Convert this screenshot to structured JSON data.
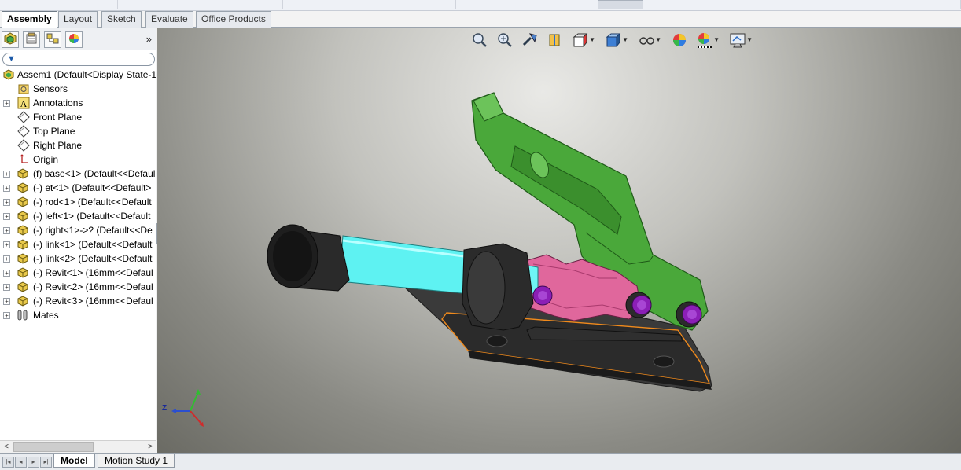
{
  "command_manager": {
    "tabs": [
      {
        "label": "Assembly",
        "active": true
      },
      {
        "label": "Layout",
        "active": false
      },
      {
        "label": "Sketch",
        "active": false
      },
      {
        "label": "Evaluate",
        "active": false
      },
      {
        "label": "Office Products",
        "active": false
      }
    ]
  },
  "left_panel": {
    "tab_icons": [
      "feature-manager-icon",
      "property-manager-icon",
      "configuration-manager-icon",
      "display-manager-icon"
    ],
    "more_glyph": "»",
    "filter_glyph": "▼",
    "tree": [
      {
        "label": "Assem1  (Default<Display State-1",
        "icon": "assembly-icon",
        "expand": false
      },
      {
        "label": "Sensors",
        "icon": "sensors-icon",
        "expand": false
      },
      {
        "label": "Annotations",
        "icon": "annotations-icon",
        "expand": true
      },
      {
        "label": "Front Plane",
        "icon": "plane-icon",
        "expand": false
      },
      {
        "label": "Top Plane",
        "icon": "plane-icon",
        "expand": false
      },
      {
        "label": "Right Plane",
        "icon": "plane-icon",
        "expand": false
      },
      {
        "label": "Origin",
        "icon": "origin-icon",
        "expand": false
      },
      {
        "label": "(f) base<1> (Default<<Defaul",
        "icon": "part-icon",
        "expand": true
      },
      {
        "label": "(-) et<1> (Default<<Default>",
        "icon": "part-icon",
        "expand": true
      },
      {
        "label": "(-) rod<1> (Default<<Default",
        "icon": "part-icon",
        "expand": true
      },
      {
        "label": "(-) left<1> (Default<<Default",
        "icon": "part-icon",
        "expand": true
      },
      {
        "label": "(-) right<1>->? (Default<<De",
        "icon": "part-icon",
        "expand": true
      },
      {
        "label": "(-) link<1> (Default<<Default",
        "icon": "part-icon",
        "expand": true
      },
      {
        "label": "(-) link<2> (Default<<Default",
        "icon": "part-icon",
        "expand": true
      },
      {
        "label": "(-) Revit<1> (16mm<<Defaul",
        "icon": "part-icon",
        "expand": true
      },
      {
        "label": "(-) Revit<2> (16mm<<Defaul",
        "icon": "part-icon",
        "expand": true
      },
      {
        "label": "(-) Revit<3> (16mm<<Defaul",
        "icon": "part-icon",
        "expand": true
      },
      {
        "label": "Mates",
        "icon": "mates-icon",
        "expand": true
      }
    ]
  },
  "view_toolbar": [
    {
      "icon": "zoom-to-fit-icon",
      "dropdown": false
    },
    {
      "icon": "zoom-to-area-icon",
      "dropdown": false
    },
    {
      "icon": "previous-view-icon",
      "dropdown": false
    },
    {
      "icon": "section-view-icon",
      "dropdown": false
    },
    {
      "icon": "view-orientation-icon",
      "dropdown": true
    },
    {
      "icon": "display-style-icon",
      "dropdown": true
    },
    {
      "icon": "hide-show-items-icon",
      "dropdown": true
    },
    {
      "icon": "edit-appearance-icon",
      "dropdown": false
    },
    {
      "icon": "apply-scene-icon",
      "dropdown": true
    },
    {
      "icon": "view-settings-icon",
      "dropdown": true
    }
  ],
  "triad": {
    "z_label": "Z"
  },
  "bottom_tabs": [
    {
      "label": "Model",
      "active": true
    },
    {
      "label": "Motion Study 1",
      "active": false
    }
  ],
  "colors": {
    "handle_green": "#4aa83a",
    "link_pink": "#e0679c",
    "rod_cyan": "#5ef2f2",
    "rivet_purple": "#8b1fb6",
    "base_dark": "#2e2e2e",
    "selection_orange": "#f08a1c"
  }
}
